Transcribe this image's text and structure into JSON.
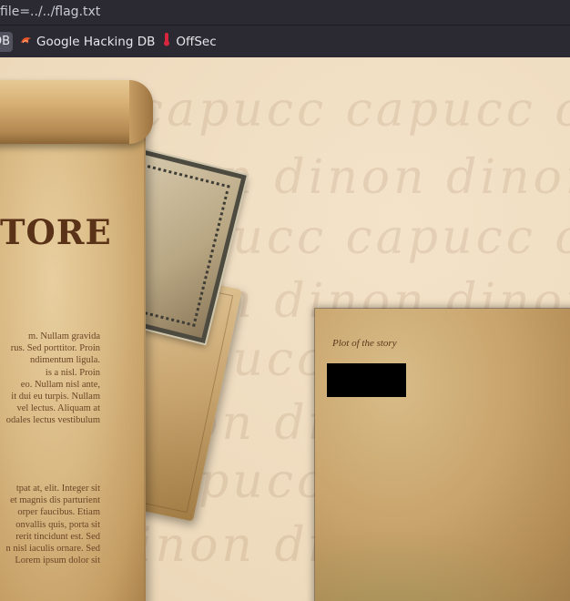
{
  "browser": {
    "url_fragment": "file=../../flag.txt",
    "bookmarks": [
      {
        "label": "DB",
        "icon": "bookmark-partial"
      },
      {
        "label": "Google Hacking DB",
        "icon": "ghdb-flame-icon"
      },
      {
        "label": "OffSec",
        "icon": "offsec-icon"
      }
    ]
  },
  "page": {
    "background_script_words": [
      "capucc",
      "dinon"
    ],
    "store_title": "TORE",
    "para1_lines": [
      "m. Nullam gravida",
      "rus. Sed porttitor. Proin",
      "ndimentum ligula.",
      "is a nisl. Proin",
      "eo. Nullam nisl ante,",
      "it dui eu turpis. Nullam",
      "vel lectus. Aliquam at",
      "odales lectus vestibulum"
    ],
    "para2_lines": [
      "tpat at, elit. Integer sit",
      "et magnis dis parturient",
      "orper faucibus. Etiam",
      "onvallis quis, porta sit",
      "rerit tincidunt est. Sed",
      "n nisl iaculis ornare. Sed",
      "Lorem ipsum dolor sit"
    ],
    "plot_title": "Plot of the story"
  },
  "colors": {
    "chrome_bg": "#2b2a33",
    "page_bg": "#efdcbf",
    "title_color": "#5a3218",
    "redaction": "#000000"
  }
}
